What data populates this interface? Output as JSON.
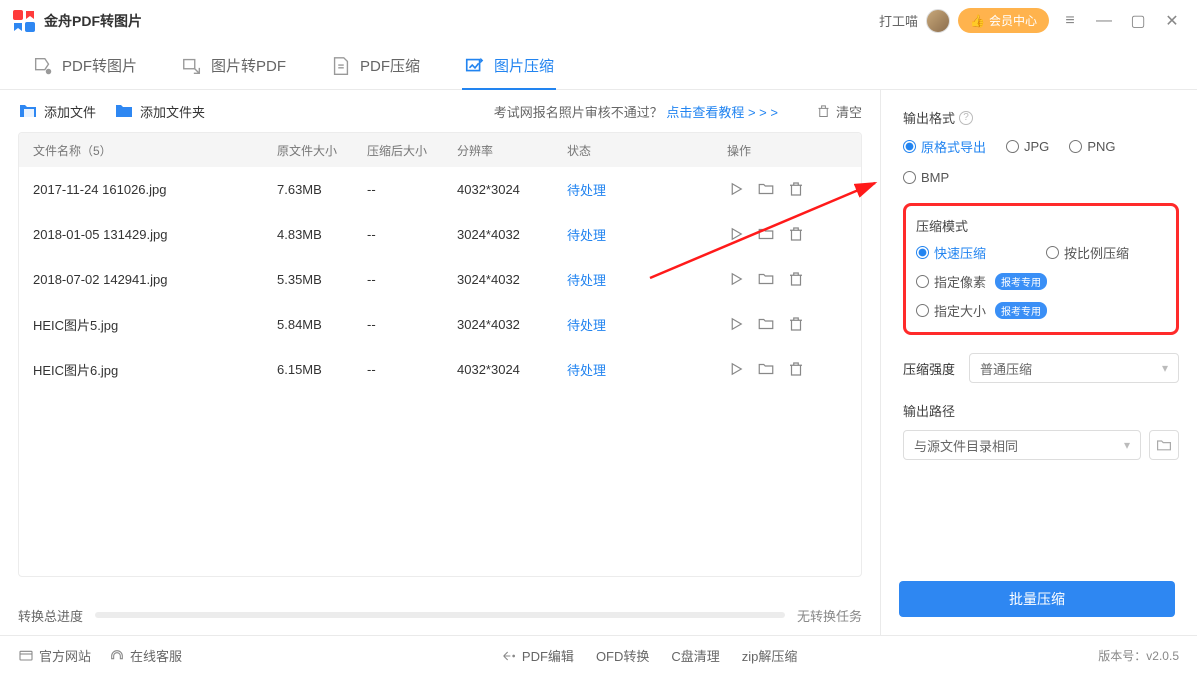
{
  "app": {
    "title": "金舟PDF转图片",
    "username": "打工喵"
  },
  "titlebar": {
    "member_btn": "会员中心"
  },
  "tabs": [
    {
      "label": "PDF转图片",
      "active": false
    },
    {
      "label": "图片转PDF",
      "active": false
    },
    {
      "label": "PDF压缩",
      "active": false
    },
    {
      "label": "图片压缩",
      "active": true
    }
  ],
  "toolbar": {
    "add_file": "添加文件",
    "add_folder": "添加文件夹",
    "hint_prefix": "考试网报名照片审核不通过？",
    "hint_link": "点击查看教程 > > >",
    "clear": "清空"
  },
  "table": {
    "headers": {
      "name": "文件名称（5）",
      "osize": "原文件大小",
      "csize": "压缩后大小",
      "res": "分辨率",
      "status": "状态",
      "act": "操作"
    },
    "rows": [
      {
        "name": "2017-11-24 161026.jpg",
        "osize": "7.63MB",
        "csize": "--",
        "res": "4032*3024",
        "status": "待处理"
      },
      {
        "name": "2018-01-05 131429.jpg",
        "osize": "4.83MB",
        "csize": "--",
        "res": "3024*4032",
        "status": "待处理"
      },
      {
        "name": "2018-07-02 142941.jpg",
        "osize": "5.35MB",
        "csize": "--",
        "res": "3024*4032",
        "status": "待处理"
      },
      {
        "name": "HEIC图片5.jpg",
        "osize": "5.84MB",
        "csize": "--",
        "res": "3024*4032",
        "status": "待处理"
      },
      {
        "name": "HEIC图片6.jpg",
        "osize": "6.15MB",
        "csize": "--",
        "res": "4032*3024",
        "status": "待处理"
      }
    ]
  },
  "progress": {
    "label": "转换总进度",
    "status": "无转换任务"
  },
  "right": {
    "output_format": {
      "title": "输出格式",
      "options": [
        "原格式导出",
        "JPG",
        "PNG",
        "BMP"
      ],
      "selected": 0
    },
    "mode": {
      "title": "压缩模式",
      "options": [
        "快速压缩",
        "按比例压缩",
        "指定像素",
        "指定大小"
      ],
      "selected": 0,
      "badge": "报考专用"
    },
    "strength": {
      "title": "压缩强度",
      "value": "普通压缩"
    },
    "path": {
      "title": "输出路径",
      "value": "与源文件目录相同"
    },
    "primary": "批量压缩"
  },
  "footer": {
    "official": "官方网站",
    "support": "在线客服",
    "center": [
      "PDF编辑",
      "OFD转换",
      "C盘清理",
      "zip解压缩"
    ],
    "version": "版本号：v2.0.5"
  }
}
